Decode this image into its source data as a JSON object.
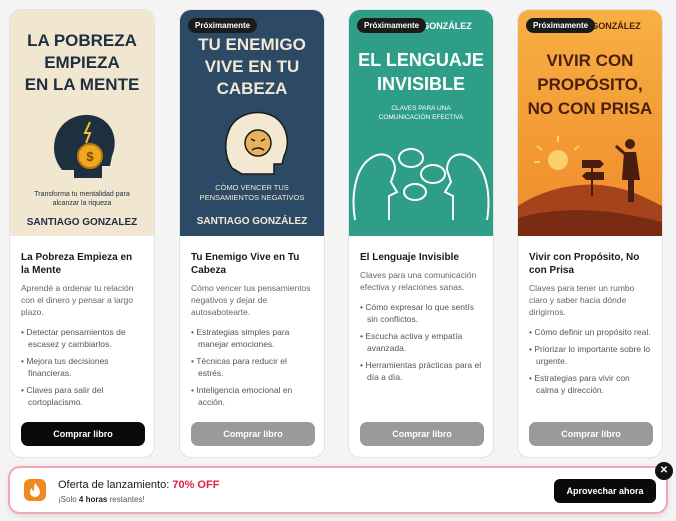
{
  "books": [
    {
      "cover": {
        "title_lines": [
          "LA POBREZA",
          "EMPIEZA",
          "EN LA MENTE"
        ],
        "subtitle_lines": [
          "Transforma tu mentalidad para",
          "alcanzar la riqueza"
        ],
        "author": "SANTIAGO GONZALEZ",
        "bg": "#f1e6cf",
        "text_color": "#1e2f40"
      },
      "title": "La Pobreza Empieza en la Mente",
      "description": "Aprendé a ordenar tu relación con el dinero y pensar a largo plazo.",
      "bullets": [
        "Detectar pensamientos de escasez y cambiarlos.",
        "Mejora tus decisiones financieras.",
        "Claves para salir del cortoplacismo."
      ],
      "button_label": "Comprar libro"
    },
    {
      "badge": "Próximamente",
      "cover": {
        "title_lines": [
          "TU ENEMIGO",
          "VIVE EN TU",
          "CABEZA"
        ],
        "subtitle_lines": [
          "CÓMO VENCER TUS",
          "PENSAMIENTOS NEGATIVOS"
        ],
        "author": "SANTIAGO GONZÁLEZ",
        "bg": "#2c4a66",
        "text_color": "#f3e8d2"
      },
      "title": "Tu Enemigo Vive en Tu Cabeza",
      "description": "Cómo vencer tus pensamientos negativos y dejar de autosabotearte.",
      "bullets": [
        "Estrategias simples para manejar emociones.",
        "Técnicas para reducir el estrés.",
        "Inteligencia emocional en acción."
      ],
      "button_label": "Comprar libro"
    },
    {
      "badge": "Próximamente",
      "cover": {
        "top_author_fragment": "GONZÁLEZ",
        "title_lines": [
          "EL LENGUAJE",
          "INVISIBLE"
        ],
        "subtitle_lines": [
          "CLAVES PARA UNA",
          "COMUNICACIÓN EFECTIVA"
        ],
        "bg": "#2f9e88",
        "text_color": "#ffffff"
      },
      "title": "El Lenguaje Invisible",
      "description": "Claves para una comunicación efectiva y relaciones sanas.",
      "bullets": [
        "Cómo expresar lo que sentís sin conflictos.",
        "Escucha activa y empatía avanzada.",
        "Herramientas prácticas para el día a día."
      ],
      "button_label": "Comprar libro"
    },
    {
      "badge": "Próximamente",
      "cover": {
        "top_author_fragment": "GONZÁLEZ",
        "title_lines": [
          "VIVIR CON",
          "PROPÓSITO,",
          "NO CON PRISA"
        ],
        "bg": "#f5a43a",
        "text_color": "#4a1e0e"
      },
      "title": "Vivir con Propósito, No con Prisa",
      "description": "Claves para tener un rumbo claro y saber hacia dónde dirigirnos.",
      "bullets": [
        "Cómo definir un propósito real.",
        "Priorizar lo importante sobre lo urgente.",
        "Estrategias para vivir con calma y dirección."
      ],
      "button_label": "Comprar libro"
    }
  ],
  "offer": {
    "title": "Oferta de lanzamiento:",
    "discount": "70% OFF",
    "sub_prefix": "¡Solo",
    "sub_bold": "4 horas",
    "sub_suffix": "restantes!",
    "button_label": "Aprovechar ahora",
    "close_symbol": "✕"
  },
  "colors": {
    "accent_red": "#e11d48",
    "button_dark": "#0a0a0a",
    "button_disabled": "#9a9a9a",
    "offer_border": "#f4a7b0"
  }
}
